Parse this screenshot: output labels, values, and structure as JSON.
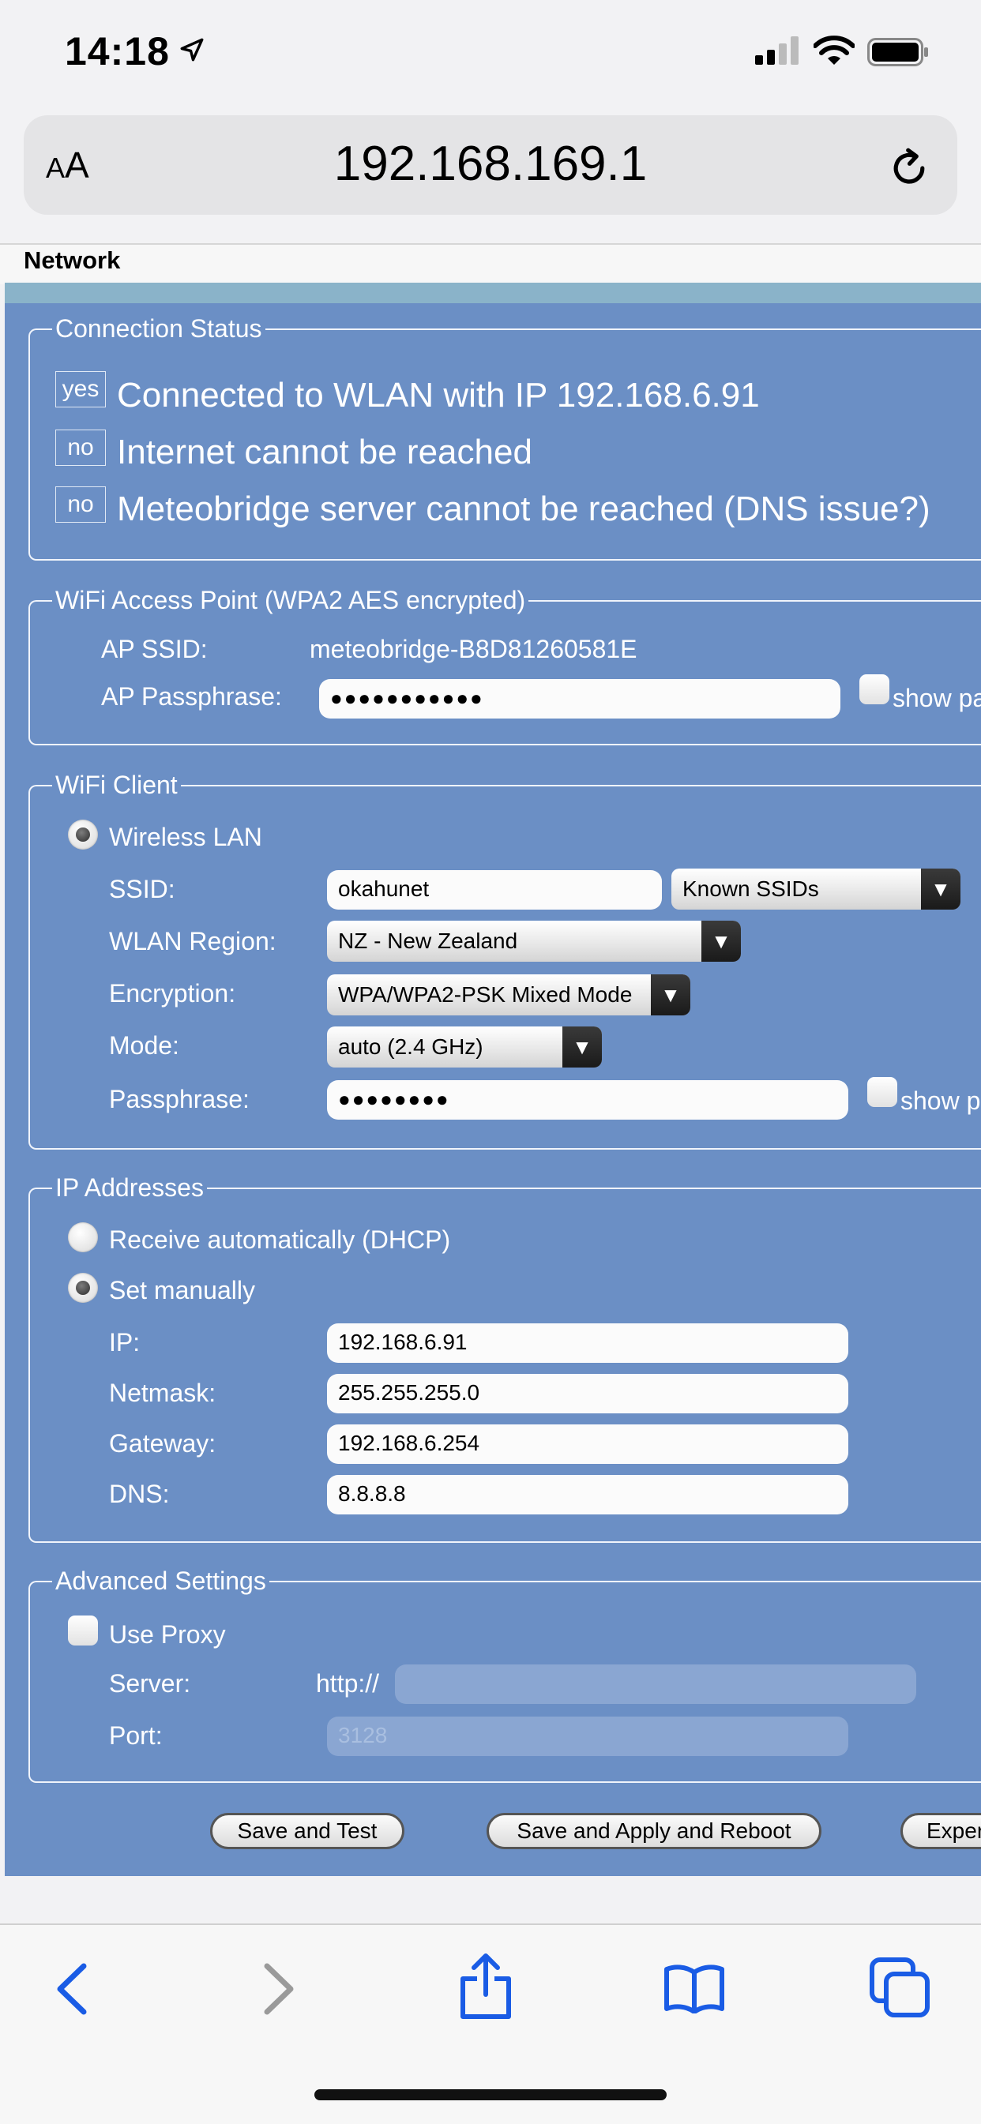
{
  "status_bar": {
    "time": "14:18"
  },
  "browser": {
    "aa_label_small": "A",
    "aa_label_big": "A",
    "url": "192.168.169.1"
  },
  "page": {
    "title": "Network"
  },
  "connection_status": {
    "legend": "Connection Status",
    "rows": [
      {
        "tag": "yes",
        "text": "Connected to WLAN with IP 192.168.6.91"
      },
      {
        "tag": "no",
        "text": "Internet cannot be reached"
      },
      {
        "tag": "no",
        "text": "Meteobridge server cannot be reached (DNS issue?)"
      }
    ]
  },
  "access_point": {
    "legend": "WiFi Access Point (WPA2 AES encrypted)",
    "ssid_label": "AP SSID:",
    "ssid_value": "meteobridge-B8D81260581E",
    "pass_label": "AP Passphrase:",
    "pass_value": "●●●●●●●●●●●",
    "show_label": "show pa"
  },
  "wifi_client": {
    "legend": "WiFi Client",
    "mode_label": "Wireless LAN",
    "ssid_label": "SSID:",
    "ssid_value": "okahunet",
    "known_ssids": "Known SSIDs",
    "region_label": "WLAN Region:",
    "region_value": "NZ - New Zealand",
    "enc_label": "Encryption:",
    "enc_value": "WPA/WPA2-PSK Mixed Mode",
    "band_label": "Mode:",
    "band_value": "auto (2.4 GHz)",
    "pass_label": "Passphrase:",
    "pass_value": "●●●●●●●●",
    "show_label": "show p"
  },
  "ip": {
    "legend": "IP Addresses",
    "dhcp_label": "Receive automatically (DHCP)",
    "manual_label": "Set manually",
    "ip_label": "IP:",
    "ip_value": "192.168.6.91",
    "netmask_label": "Netmask:",
    "netmask_value": "255.255.255.0",
    "gateway_label": "Gateway:",
    "gateway_value": "192.168.6.254",
    "dns_label": "DNS:",
    "dns_value": "8.8.8.8"
  },
  "advanced": {
    "legend": "Advanced Settings",
    "proxy_label": "Use Proxy",
    "server_label": "Server:",
    "server_prefix": "http://",
    "server_value": "",
    "port_label": "Port:",
    "port_placeholder": "3128"
  },
  "buttons": {
    "save_test": "Save and Test",
    "save_apply": "Save and Apply and Reboot",
    "expert": "Exper"
  },
  "colors": {
    "panel": "#6b8fc5",
    "topbar": "#8ab3c9",
    "ios_blue": "#1a5ce5"
  }
}
